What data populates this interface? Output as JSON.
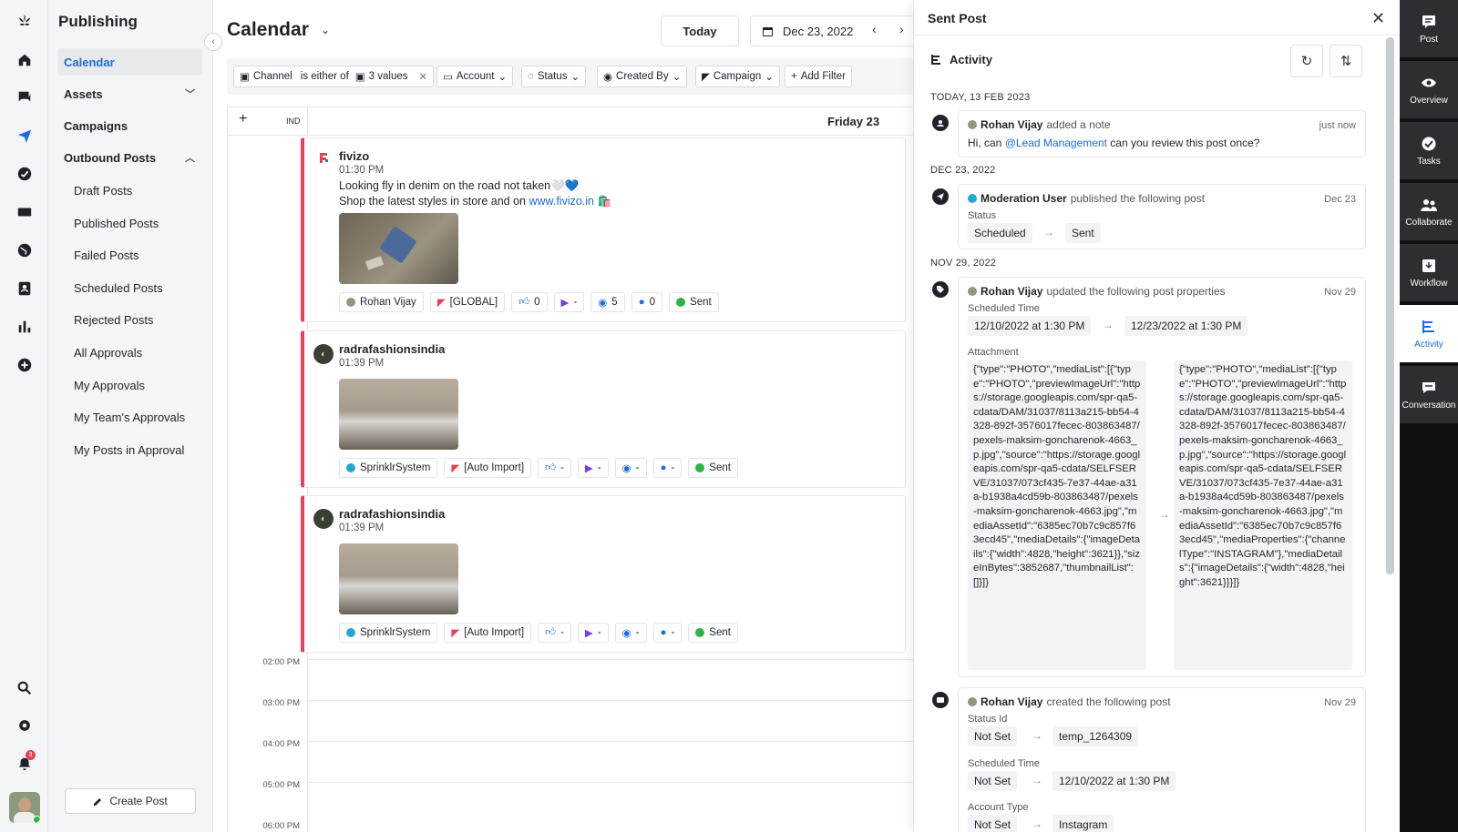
{
  "nav": {
    "title": "Publishing",
    "calendar": "Calendar",
    "assets": "Assets",
    "campaigns": "Campaigns",
    "outbound": "Outbound Posts",
    "sub": [
      "Draft Posts",
      "Published Posts",
      "Failed Posts",
      "Scheduled Posts",
      "Rejected Posts",
      "All Approvals",
      "My Approvals",
      "My Team's Approvals",
      "My Posts in Approval"
    ],
    "create": "Create Post",
    "notif_count": "3"
  },
  "main": {
    "title": "Calendar",
    "today": "Today",
    "date": "Dec 23, 2022",
    "filters": {
      "channel": "Channel",
      "either": "is either of",
      "values": "3 values",
      "account": "Account",
      "status": "Status",
      "created_by": "Created By",
      "campaign": "Campaign",
      "add": "Add Filter"
    },
    "grid": {
      "plus": "+",
      "tz": "IND",
      "day": "Friday 23",
      "times": [
        "02:00 PM",
        "03:00 PM",
        "04:00 PM",
        "05:00 PM",
        "06:00 PM"
      ]
    },
    "posts": [
      {
        "account": "fivizo",
        "time": "01:30 PM",
        "line1": "Looking fly in denim on the road not taken🤍💙",
        "line2a": "Shop the latest styles in store and on ",
        "link": "www.fivizo.in",
        "line2b": " 🛍️",
        "user": "Rohan Vijay",
        "campaign": "[GLOBAL]",
        "likes": "0",
        "shares": "-",
        "views": "5",
        "comments": "0",
        "status": "Sent"
      },
      {
        "account": "radrafashionsindia",
        "time": "01:39 PM",
        "user": "SprinklrSystem",
        "campaign": "[Auto Import]",
        "likes": "-",
        "shares": "-",
        "views": "-",
        "comments": "-",
        "status": "Sent"
      },
      {
        "account": "radrafashionsindia",
        "time": "01:39 PM",
        "user": "SprinklrSystem",
        "campaign": "[Auto Import]",
        "likes": "-",
        "shares": "-",
        "views": "-",
        "comments": "-",
        "status": "Sent"
      }
    ]
  },
  "panel": {
    "title": "Sent Post",
    "activity": "Activity",
    "d1": "TODAY, 13 FEB 2023",
    "d2": "DEC 23, 2022",
    "d3": "NOV 29, 2022",
    "note": {
      "user": "Rohan Vijay",
      "action": "added a note",
      "date": "just now",
      "text_a": "Hi, can ",
      "mention": "@Lead Management",
      "text_b": " can you review this post once?"
    },
    "pub": {
      "user": "Moderation User",
      "action": "published the following post",
      "date": "Dec 23",
      "status_label": "Status",
      "from": "Scheduled",
      "to": "Sent"
    },
    "upd": {
      "user": "Rohan Vijay",
      "action": "updated the following post properties",
      "date": "Nov 29",
      "sched_label": "Scheduled Time",
      "from": "12/10/2022 at 1:30 PM",
      "to": "12/23/2022 at 1:30 PM",
      "attach_label": "Attachment",
      "json_from": "{\"type\":\"PHOTO\",\"mediaList\":[{\"type\":\"PHOTO\",\"previewImageUrl\":\"https://storage.googleapis.com/spr-qa5-cdata/DAM/31037/8113a215-bb54-4328-892f-3576017fecec-803863487/pexels-maksim-goncharenok-4663_p.jpg\",\"source\":\"https://storage.googleapis.com/spr-qa5-cdata/SELFSERVE/31037/073cf435-7e37-44ae-a31a-b1938a4cd59b-803863487/pexels-maksim-goncharenok-4663.jpg\",\"mediaAssetId\":\"6385ec70b7c9c857f63ecd45\",\"mediaDetails\":{\"imageDetails\":{\"width\":4828,\"height\":3621}},\"sizeInBytes\":3852687,\"thumbnailList\":[]}]}",
      "json_to": "{\"type\":\"PHOTO\",\"mediaList\":[{\"type\":\"PHOTO\",\"previewImageUrl\":\"https://storage.googleapis.com/spr-qa5-cdata/DAM/31037/8113a215-bb54-4328-892f-3576017fecec-803863487/pexels-maksim-goncharenok-4663_p.jpg\",\"source\":\"https://storage.googleapis.com/spr-qa5-cdata/SELFSERVE/31037/073cf435-7e37-44ae-a31a-b1938a4cd59b-803863487/pexels-maksim-goncharenok-4663.jpg\",\"mediaAssetId\":\"6385ec70b7c9c857f63ecd45\",\"mediaProperties\":{\"channelType\":\"INSTAGRAM\"},\"mediaDetails\":{\"imageDetails\":{\"width\":4828,\"height\":3621}}}]}"
    },
    "crt": {
      "user": "Rohan Vijay",
      "action": "created the following post",
      "date": "Nov 29",
      "status_label": "Status Id",
      "s_from": "Not Set",
      "s_to": "temp_1264309",
      "sched_label": "Scheduled Time",
      "t_from": "Not Set",
      "t_to": "12/10/2022 at 1:30 PM",
      "acct_label": "Account Type",
      "a_from": "Not Set",
      "a_to": "Instagram"
    }
  },
  "rail": {
    "post": "Post",
    "overview": "Overview",
    "tasks": "Tasks",
    "collaborate": "Collaborate",
    "workflow": "Workflow",
    "activity": "Activity",
    "conversation": "Conversation"
  },
  "colors": {
    "accent": "#1b6ed8",
    "post_border": "#e8405c",
    "sent": "#2fb344"
  }
}
